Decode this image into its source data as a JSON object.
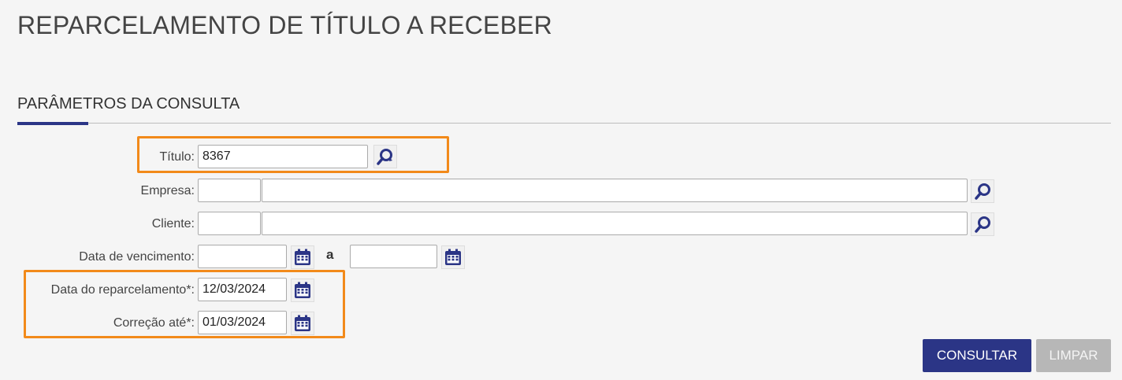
{
  "header": {
    "title": "REPARCELAMENTO DE TÍTULO A RECEBER"
  },
  "section": {
    "title": "PARÂMETROS DA CONSULTA"
  },
  "form": {
    "titulo": {
      "label": "Título:",
      "value": "8367"
    },
    "empresa": {
      "label": "Empresa:",
      "code_value": "",
      "name_value": ""
    },
    "cliente": {
      "label": "Cliente:",
      "code_value": "",
      "name_value": ""
    },
    "vencimento": {
      "label": "Data de vencimento:",
      "from_value": "",
      "separator": "a",
      "to_value": ""
    },
    "reparcelamento": {
      "label": "Data do reparcelamento*:",
      "value": "12/03/2024"
    },
    "correcao": {
      "label": "Correção até*:",
      "value": "01/03/2024"
    }
  },
  "actions": {
    "consultar_label": "CONSULTAR",
    "limpar_label": "LIMPAR"
  },
  "colors": {
    "primary": "#2b3586",
    "highlight": "#f28a1a",
    "disabled": "#b7b7b7"
  },
  "icons": {
    "search": "search-icon",
    "search_refresh": "search-refresh-icon",
    "calendar": "calendar-icon"
  }
}
